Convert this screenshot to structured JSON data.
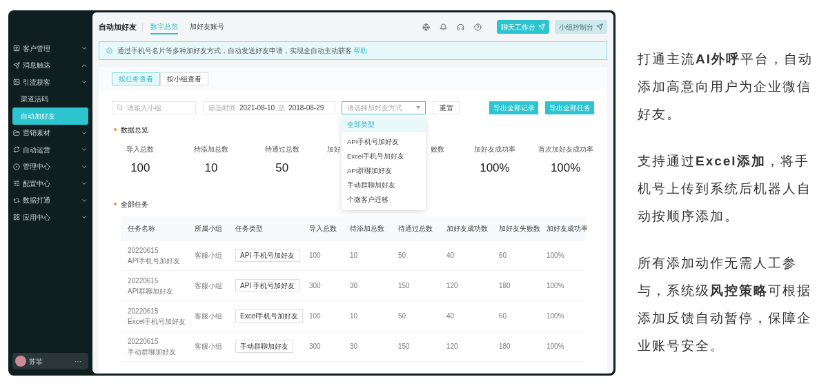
{
  "sidebar": {
    "items": [
      {
        "label": "客户管理",
        "expanded": false
      },
      {
        "label": "消息触达",
        "expanded": true
      },
      {
        "label": "引流获客",
        "expanded": false,
        "children": [
          {
            "label": "渠道活码",
            "selected": false
          },
          {
            "label": "自动加好友",
            "selected": true
          }
        ]
      },
      {
        "label": "营销素材",
        "expanded": false
      },
      {
        "label": "自动运营",
        "expanded": false
      },
      {
        "label": "管理中心",
        "expanded": false
      },
      {
        "label": "配置中心",
        "expanded": false
      },
      {
        "label": "数据打通",
        "expanded": false
      },
      {
        "label": "应用中心",
        "expanded": false
      }
    ],
    "user": {
      "name": "苏菲",
      "more": "···"
    }
  },
  "header": {
    "title": "自动加好友",
    "tabs": [
      {
        "label": "数字总览",
        "selected": true
      },
      {
        "label": "加好友账号",
        "selected": false
      }
    ],
    "buttons": [
      {
        "label": "聊天工作台",
        "kind": "primary"
      },
      {
        "label": "小组控制台",
        "kind": "secondary"
      }
    ]
  },
  "notice": {
    "text": "通过手机号名片等多种加好友方式，自动发送好友申请，实现全自动主动获客",
    "link": "帮助"
  },
  "view_toggle": [
    {
      "label": "按任务查看",
      "selected": true
    },
    {
      "label": "按小组查看",
      "selected": false
    }
  ],
  "filters": {
    "search": {
      "placeholder": "请输入小组"
    },
    "date": {
      "label": "筛选时间",
      "start": "2021-08-10",
      "separator": "至",
      "end": "2018-08-29"
    },
    "select": {
      "placeholder": "请选择加好友方式",
      "options": [
        {
          "label": "全部类型",
          "selected": true
        },
        {
          "label": "API手机号加好友",
          "selected": false
        },
        {
          "label": "Excel手机号加好友",
          "selected": false
        },
        {
          "label": "API群聊加好友",
          "selected": false
        },
        {
          "label": "手动群聊加好友",
          "selected": false
        },
        {
          "label": "个微客户迁移",
          "selected": false
        }
      ]
    },
    "reset": "重置",
    "exports": [
      "导出全部记录",
      "导出全部任务"
    ]
  },
  "overview": {
    "title": "数据总览",
    "stats": [
      {
        "label": "导入总数",
        "value": "100",
        "kind": "full"
      },
      {
        "label": "待添加总数",
        "value": "10",
        "kind": "full"
      },
      {
        "label": "待通过总数",
        "value": "50",
        "kind": "full"
      },
      {
        "label": "加好",
        "kind": "cut_right"
      },
      {
        "label": "败数",
        "kind": "cut_left"
      },
      {
        "label": "加好友成功率",
        "value": "100%",
        "kind": "full"
      },
      {
        "label": "首次加好友成功率",
        "value": "100%",
        "kind": "full"
      }
    ]
  },
  "tasks": {
    "title": "全部任务",
    "columns": [
      "任务名称",
      "所属小组",
      "任务类型",
      "导入总数",
      "待添加总数",
      "待通过总数",
      "加好友成功数",
      "加好友失败数",
      "加好友成功率"
    ],
    "rows": [
      [
        "20220615\nAPI手机号加好友",
        "客服小组",
        "API 手机号加好友",
        "100",
        "10",
        "50",
        "40",
        "60",
        "100%"
      ],
      [
        "20220615\nAPI群聊加好友",
        "客服小组",
        "API 手机号加好友",
        "300",
        "30",
        "150",
        "120",
        "180",
        "100%"
      ],
      [
        "20220615\nExcel手机号加好友",
        "客服小组",
        "Excel手机号加好友",
        "100",
        "10",
        "50",
        "40",
        "60",
        "100%"
      ],
      [
        "20220615\n手动群聊加好友",
        "客服小组",
        "手动群聊加好友",
        "300",
        "30",
        "150",
        "120",
        "180",
        "100%"
      ]
    ]
  },
  "promo": [
    "打通主流**AI外呼**平台，自动添加高意向用户为企业微信好友。",
    "支持通过**Excel添加**，将手机号上传到系统后机器人自动按顺序添加。",
    "所有添加动作无需人工参与，系统级**风控策略**可根据添加反馈自动暂停，保障企业账号安全。"
  ]
}
